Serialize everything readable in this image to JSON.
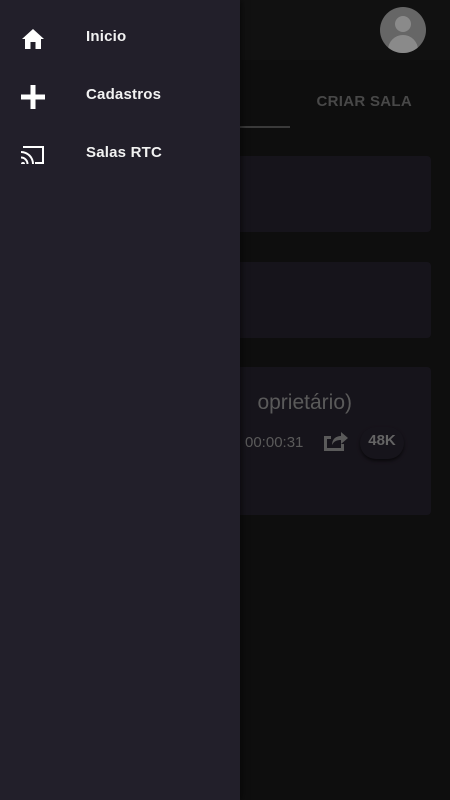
{
  "drawer": {
    "items": [
      {
        "label": "Inicio",
        "icon": "home-icon"
      },
      {
        "label": "Cadastros",
        "icon": "plus-icon"
      },
      {
        "label": "Salas RTC",
        "icon": "cast-icon"
      }
    ]
  },
  "tabs": {
    "criar_sala": "CRIAR SALA"
  },
  "cards": {
    "room": {
      "title_fragment": "oprietário)",
      "time": "00:00:31",
      "viewers_badge": "48K"
    }
  },
  "colors": {
    "drawer_bg": "#221f2a",
    "card_bg": "#231f2a",
    "app_bg": "#161616"
  }
}
